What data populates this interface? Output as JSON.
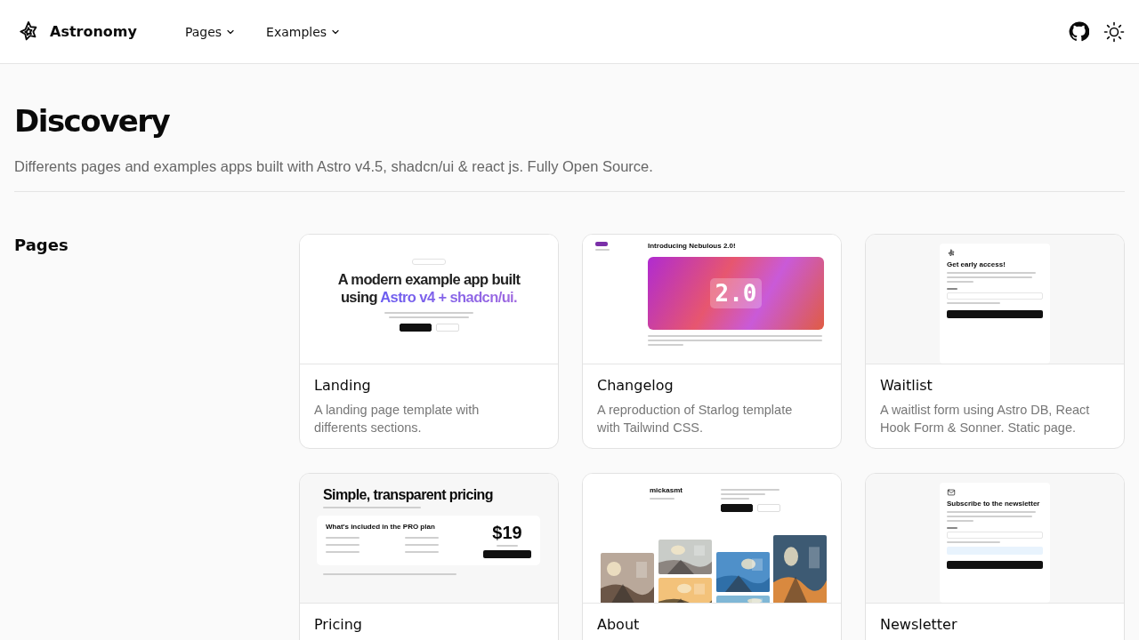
{
  "header": {
    "brand": "Astronomy",
    "nav": [
      {
        "label": "Pages"
      },
      {
        "label": "Examples"
      }
    ]
  },
  "page": {
    "title": "Discovery",
    "subtitle": "Differents pages and examples apps built with Astro v4.5, shadcn/ui & react js. Fully Open Source."
  },
  "section": {
    "heading": "Pages",
    "cards": [
      {
        "title": "Landing",
        "description": "A landing page template with differents sections.",
        "preview": {
          "kind": "landing",
          "headline": "A modern example app built using ",
          "highlight": "Astro v4 + shadcn/ui."
        }
      },
      {
        "title": "Changelog",
        "description": "A reproduction of Starlog template with Tailwind CSS.",
        "preview": {
          "kind": "changelog",
          "heading": "Introducing Nebulous 2.0!",
          "banner": "2.0"
        }
      },
      {
        "title": "Waitlist",
        "description": "A waitlist form using Astro DB, React Hook Form & Sonner. Static page.",
        "preview": {
          "kind": "waitlist",
          "heading": "Get early access!"
        }
      },
      {
        "title": "Pricing",
        "preview": {
          "kind": "pricing",
          "heading": "Simple, transparent pricing",
          "plan": "What's included in the PRO plan",
          "price": "$19"
        }
      },
      {
        "title": "About",
        "preview": {
          "kind": "about",
          "name": "mickasmt"
        }
      },
      {
        "title": "Newsletter",
        "preview": {
          "kind": "newsletter",
          "heading": "Subscribe to the newsletter"
        }
      }
    ]
  }
}
